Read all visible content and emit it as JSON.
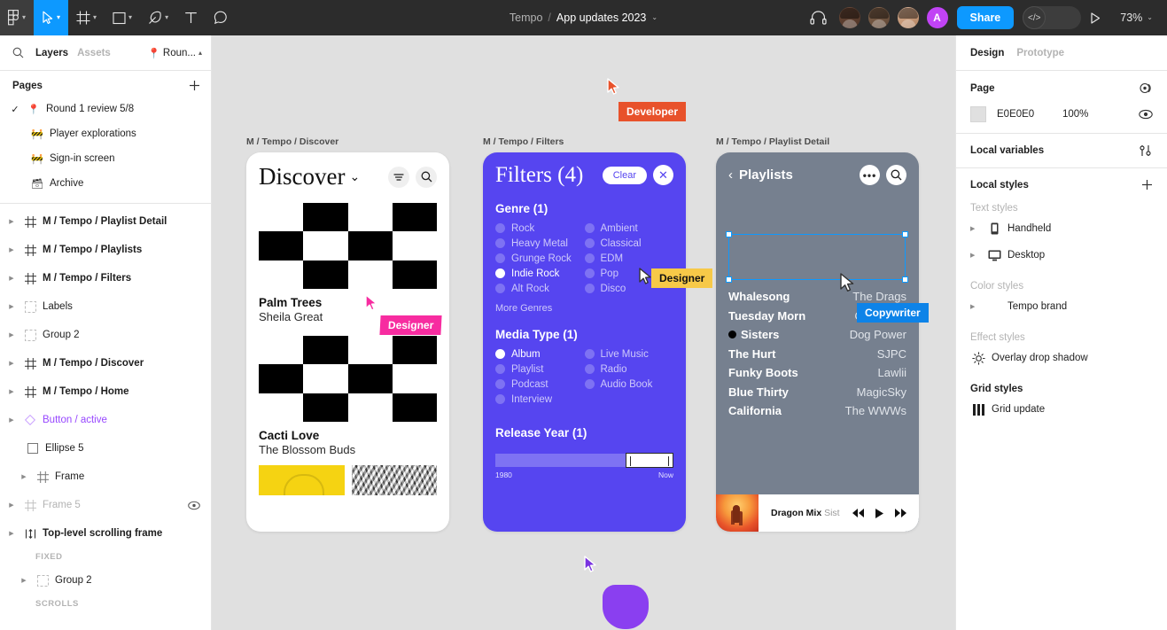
{
  "toolbar": {
    "tools": [
      {
        "name": "figma-logo-icon",
        "label": "Figma menu",
        "caret": true
      },
      {
        "name": "move-tool-icon",
        "label": "Move",
        "caret": true
      },
      {
        "name": "frame-tool-icon",
        "label": "Frame",
        "caret": true
      },
      {
        "name": "shape-tool-icon",
        "label": "Rectangle",
        "caret": true
      },
      {
        "name": "pen-tool-icon",
        "label": "Pen",
        "caret": true
      },
      {
        "name": "text-tool-icon",
        "label": "Text",
        "caret": false
      },
      {
        "name": "comment-tool-icon",
        "label": "Comment",
        "caret": false
      }
    ],
    "project_name": "Tempo",
    "separator": "/",
    "file_name": "App updates 2023",
    "file_caret": "⌄",
    "headphones_label": "Audio",
    "collaborator_initial": "A",
    "share_label": "Share",
    "devmode_label": "</>",
    "present_label": "Present",
    "zoom_level": "73%",
    "zoom_caret": "⌄"
  },
  "left_panel": {
    "tabs": [
      {
        "label": "Layers",
        "active": true
      },
      {
        "label": "Assets",
        "active": false
      }
    ],
    "search_label": "Search",
    "page_chip": "Roun...",
    "pages_title": "Pages",
    "pages_add_label": "+",
    "pages": [
      {
        "label": "Round 1 review 5/8",
        "icon": "pin-icon",
        "checked": true,
        "sub": false
      },
      {
        "label": "Player explorations",
        "icon": "fence-icon",
        "checked": false,
        "sub": true
      },
      {
        "label": "Sign-in screen",
        "icon": "fence-icon",
        "checked": false,
        "sub": true
      },
      {
        "label": "Archive",
        "icon": "archive-box-icon",
        "checked": false,
        "sub": true
      }
    ],
    "layers": [
      {
        "label": "M / Tempo / Playlist Detail",
        "icon": "component-frame-icon",
        "style": "bold",
        "arrow": true,
        "indent": 0
      },
      {
        "label": "M / Tempo / Playlists",
        "icon": "component-frame-icon",
        "style": "bold",
        "arrow": true,
        "indent": 0
      },
      {
        "label": "M / Tempo / Filters",
        "icon": "component-frame-icon",
        "style": "bold",
        "arrow": true,
        "indent": 0
      },
      {
        "label": "Labels",
        "icon": "group-icon",
        "style": "normal",
        "arrow": true,
        "indent": 0
      },
      {
        "label": "Group 2",
        "icon": "group-icon",
        "style": "normal",
        "arrow": true,
        "indent": 0
      },
      {
        "label": "M / Tempo / Discover",
        "icon": "component-frame-icon",
        "style": "bold",
        "arrow": true,
        "indent": 0
      },
      {
        "label": "M / Tempo / Home",
        "icon": "component-frame-icon",
        "style": "bold",
        "arrow": true,
        "indent": 0
      },
      {
        "label": "Button / active",
        "icon": "component-icon",
        "style": "purple",
        "arrow": true,
        "indent": 0
      },
      {
        "label": "Ellipse 5",
        "icon": "ellipse-icon",
        "style": "normal",
        "arrow": false,
        "indent": 2
      },
      {
        "label": "Frame",
        "icon": "frame-icon",
        "style": "normal",
        "arrow": true,
        "indent": 1
      },
      {
        "label": "Frame 5",
        "icon": "frame-icon",
        "style": "dim",
        "arrow": true,
        "indent": 0,
        "eye": true
      },
      {
        "label": "Top-level scrolling frame",
        "icon": "scroll-frame-icon",
        "style": "bold",
        "arrow": true,
        "indent": 0
      }
    ],
    "caption_fixed": "FIXED",
    "fixed_items": [
      {
        "label": "Group 2",
        "icon": "group-icon",
        "style": "normal",
        "arrow": true,
        "indent": 1
      }
    ],
    "caption_scrolls": "SCROLLS"
  },
  "canvas": {
    "frames": [
      {
        "label": "M / Tempo / Discover"
      },
      {
        "label": "M / Tempo / Filters"
      },
      {
        "label": "M / Tempo / Playlist Detail"
      }
    ],
    "discover": {
      "title": "Discover",
      "caret": "⌄",
      "filter_icon": "filter-icon",
      "search_icon": "search-icon",
      "albums": [
        {
          "title": "Palm Trees",
          "artist": "Sheila Great"
        },
        {
          "title": "Cacti Love",
          "artist": "The Blossom Buds"
        }
      ]
    },
    "filters": {
      "title": "Filters (4)",
      "clear_label": "Clear",
      "close_label": "✕",
      "genre_title": "Genre (1)",
      "genre_left": [
        {
          "label": "Rock",
          "selected": false
        },
        {
          "label": "Heavy Metal",
          "selected": false
        },
        {
          "label": "Grunge Rock",
          "selected": false
        },
        {
          "label": "Indie Rock",
          "selected": true
        },
        {
          "label": "Alt Rock",
          "selected": false
        }
      ],
      "genre_right": [
        {
          "label": "Ambient",
          "selected": false
        },
        {
          "label": "Classical",
          "selected": false
        },
        {
          "label": "EDM",
          "selected": false
        },
        {
          "label": "Pop",
          "selected": false
        },
        {
          "label": "Disco",
          "selected": false
        }
      ],
      "more_genres": "More Genres",
      "media_title": "Media Type (1)",
      "media_left": [
        {
          "label": "Album",
          "selected": true
        },
        {
          "label": "Playlist",
          "selected": false
        },
        {
          "label": "Podcast",
          "selected": false
        },
        {
          "label": "Interview",
          "selected": false
        }
      ],
      "media_right": [
        {
          "label": "Live Music",
          "selected": false
        },
        {
          "label": "Radio",
          "selected": false
        },
        {
          "label": "Audio Book",
          "selected": false
        }
      ],
      "release_title": "Release Year (1)",
      "slider_min_label": "1980",
      "slider_max_label": "Now"
    },
    "playlist": {
      "back_label": "‹",
      "title": "Playlists",
      "more_label": "•••",
      "search_icon": "search-icon",
      "tracks": [
        {
          "name": "Whalesong",
          "artist": "The Drags",
          "playing": false
        },
        {
          "name": "Tuesday Morn",
          "artist": "OHYEAH!",
          "playing": false
        },
        {
          "name": "Sisters",
          "artist": "Dog Power",
          "playing": true
        },
        {
          "name": "The Hurt",
          "artist": "SJPC",
          "playing": false
        },
        {
          "name": "Funky Boots",
          "artist": "Lawlii",
          "playing": false
        },
        {
          "name": "Blue Thirty",
          "artist": "MagicSky",
          "playing": false
        },
        {
          "name": "California",
          "artist": "The WWWs",
          "playing": false
        }
      ],
      "player": {
        "track": "Dragon Mix",
        "artist": "Sist",
        "prev_icon": "rewind-icon",
        "play_icon": "play-icon",
        "next_icon": "fast-forward-icon"
      }
    },
    "cursors": [
      {
        "label": "Developer",
        "color": "#e8522b"
      },
      {
        "label": "Designer",
        "color": "#f72ca0"
      },
      {
        "label": "Designer",
        "color": "#f7c948"
      },
      {
        "label": "Copywriter",
        "color": "#0d83e8"
      }
    ]
  },
  "right_panel": {
    "tabs": [
      {
        "label": "Design",
        "active": true
      },
      {
        "label": "Prototype",
        "active": false
      }
    ],
    "page_title": "Page",
    "page_settings_icon": "page-settings-icon",
    "fill_hex": "E0E0E0",
    "fill_opacity": "100%",
    "fill_visibility_icon": "eye-icon",
    "local_variables_title": "Local variables",
    "local_variables_icon": "sliders-icon",
    "local_styles_title": "Local styles",
    "local_styles_add": "+",
    "text_styles_cap": "Text styles",
    "text_styles": [
      {
        "label": "Handheld",
        "icon": "mobile-icon"
      },
      {
        "label": "Desktop",
        "icon": "desktop-icon"
      }
    ],
    "color_styles_cap": "Color styles",
    "color_styles": [
      {
        "label": "Tempo brand",
        "icon": "color-swatch-icon"
      }
    ],
    "effect_styles_cap": "Effect styles",
    "effect_styles": [
      {
        "label": "Overlay drop shadow",
        "icon": "effect-icon"
      }
    ],
    "grid_styles_cap": "Grid styles",
    "grid_styles": [
      {
        "label": "Grid update",
        "icon": "grid-icon"
      }
    ]
  }
}
